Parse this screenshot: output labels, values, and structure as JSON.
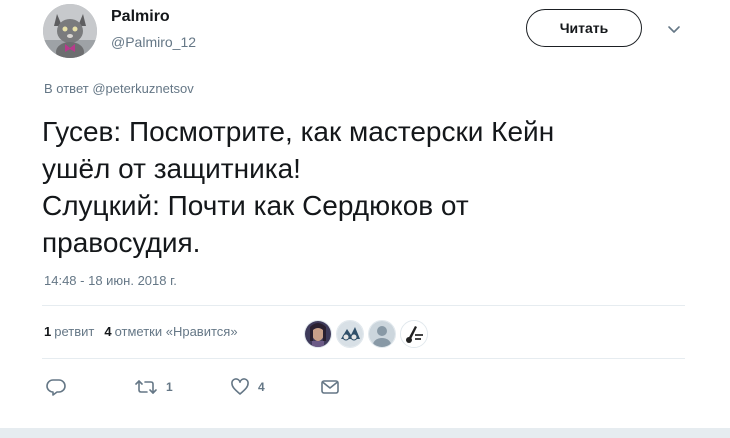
{
  "user": {
    "display_name": "Palmiro",
    "handle": "@Palmiro_12",
    "avatar_icon": "cat-avatar"
  },
  "follow_button": {
    "label": "Читать"
  },
  "menu": {
    "icon": "chevron-down-icon"
  },
  "reply_context": {
    "prefix": "В ответ",
    "mention": "@peterkuznetsov"
  },
  "tweet": {
    "lines": [
      "Гусев: Посмотрите, как мастерски Кейн",
      "ушёл от защитника!",
      "Слуцкий: Почти как Сердюков от",
      "правосудия."
    ],
    "timestamp": "14:48 - 18 июн. 2018 г."
  },
  "stats": {
    "retweet_count": "1",
    "retweet_label": "ретвит",
    "like_count": "4",
    "like_label": "отметки «Нравится»"
  },
  "likers": [
    {
      "icon": "liker-avatar-portrait"
    },
    {
      "icon": "liker-avatar-cartoon"
    },
    {
      "icon": "liker-avatar-default"
    },
    {
      "icon": "liker-avatar-logo"
    }
  ],
  "actions": {
    "reply": {
      "icon": "reply-icon",
      "count": ""
    },
    "retweet": {
      "icon": "retweet-icon",
      "count": "1"
    },
    "like": {
      "icon": "heart-icon",
      "count": "4"
    },
    "dm": {
      "icon": "envelope-icon"
    }
  },
  "colors": {
    "text": "#14171a",
    "secondary": "#657786",
    "divider": "#e6ecf0"
  }
}
